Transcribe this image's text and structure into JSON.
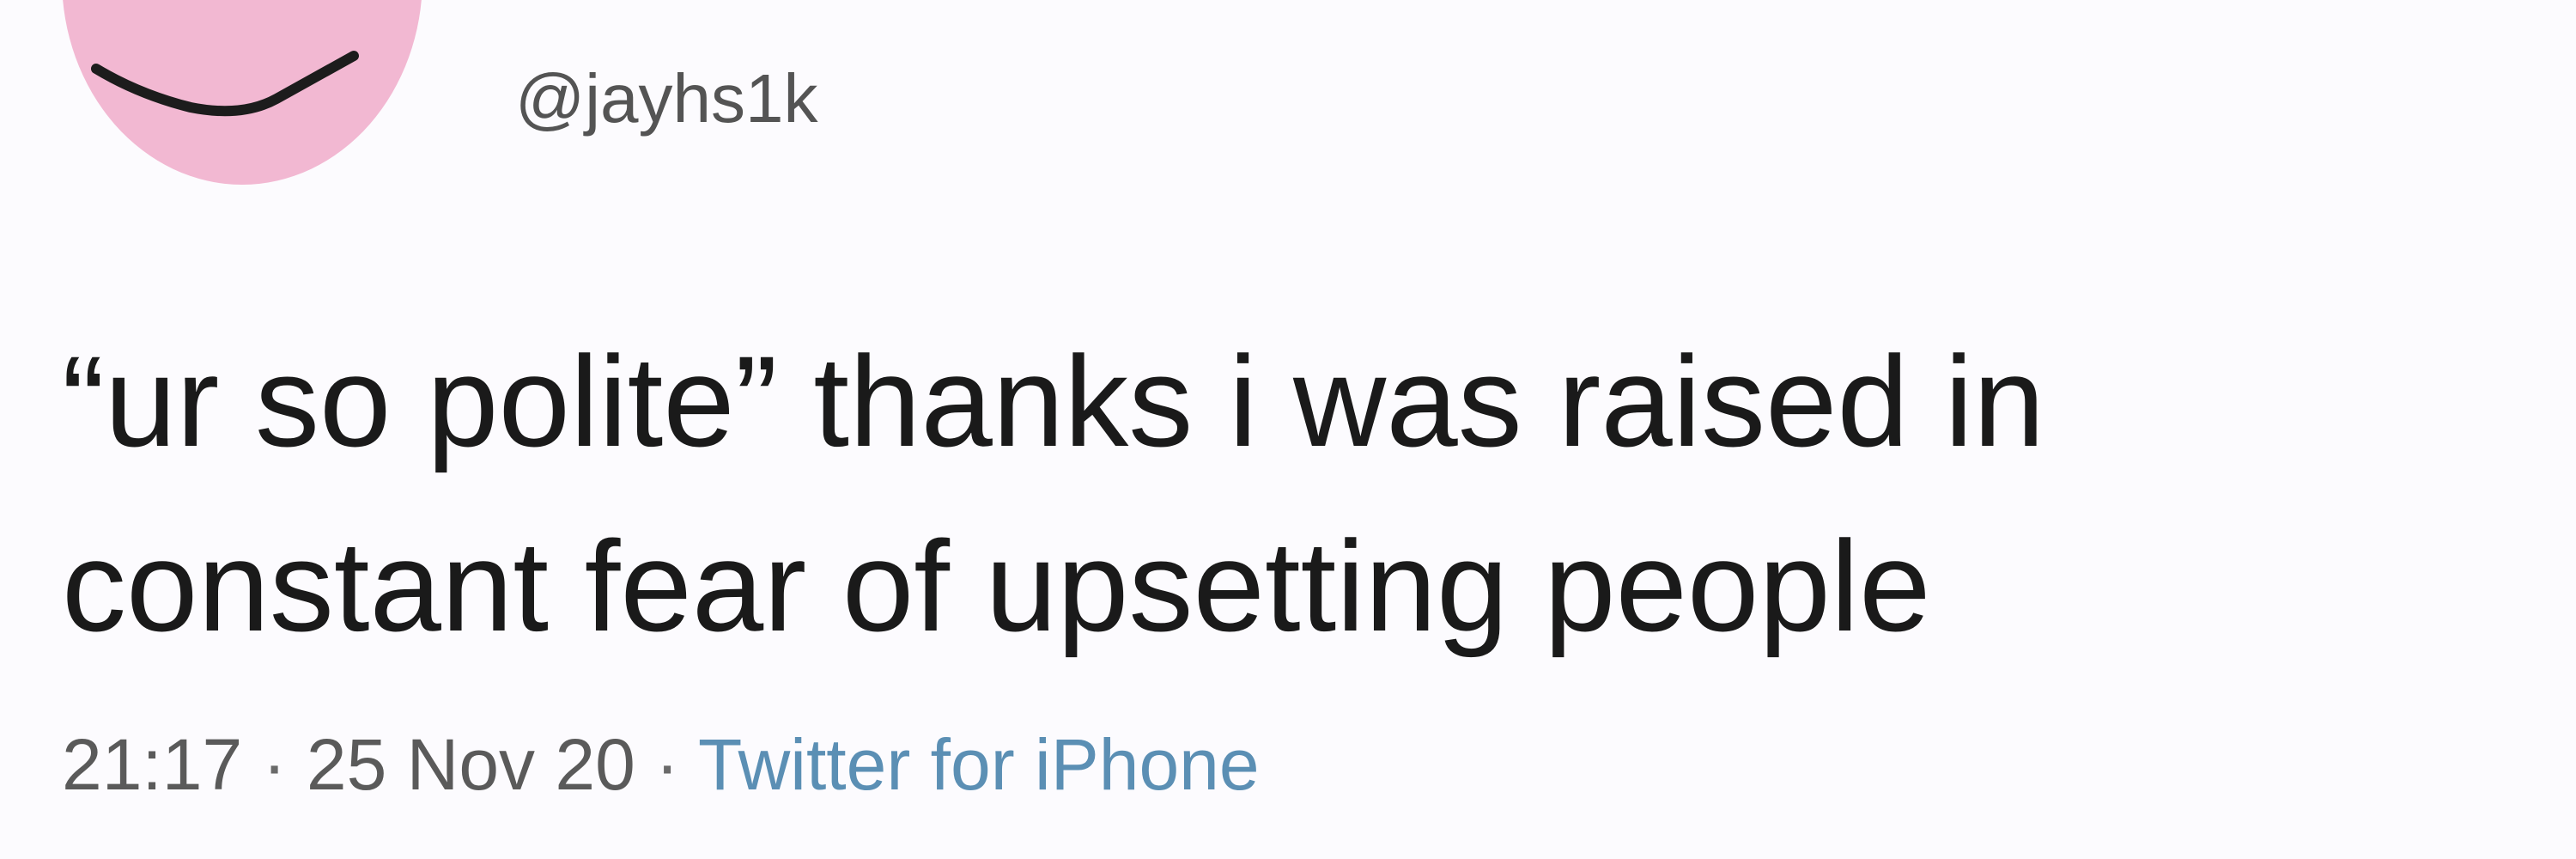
{
  "user": {
    "handle": "@jayhs1k",
    "avatar_icon": "smiley-face-avatar",
    "avatar_color": "#f2b8d2"
  },
  "tweet": {
    "text_lines": [
      "“ur so polite” thanks i was raised in",
      "constant fear of upsetting people"
    ],
    "time": "21:17",
    "separator": "·",
    "date": "25 Nov 20",
    "source": "Twitter for iPhone"
  },
  "colors": {
    "background": "#fcfbfe",
    "text": "#1a1a1a",
    "meta_text": "#5a5a5a",
    "source_link": "#5b8fb4"
  }
}
